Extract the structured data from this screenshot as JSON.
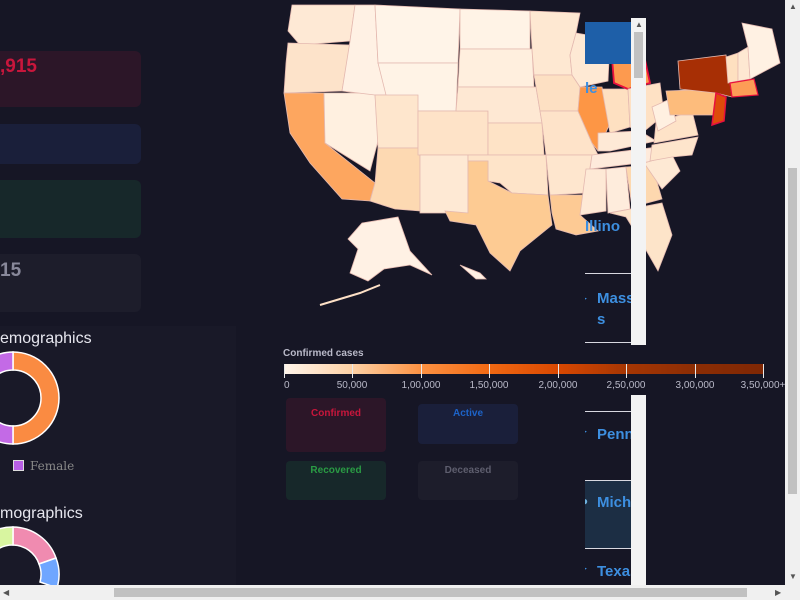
{
  "stats": {
    "confirmed_value": ",915",
    "deceased_value": "15"
  },
  "demographics": {
    "gender_title": "emographics",
    "gender_legend_female": "Female",
    "ethnicity_title": "mographics"
  },
  "state_list": {
    "items": [
      "Illino",
      "Mass\ns",
      "Penn",
      "Mich",
      "Texas"
    ],
    "partial_top_label": "le"
  },
  "scale": {
    "title": "Confirmed cases",
    "ticks": [
      "0",
      "50,000",
      "1,00,000",
      "1,50,000",
      "2,00,000",
      "2,50,000",
      "3,00,000",
      "3,50,000+"
    ]
  },
  "mini_cards": {
    "confirmed": "Confirmed",
    "active": "Active",
    "recovered": "Recovered",
    "deceased": "Deceased"
  },
  "colors": {
    "confirmed": "#c8163c",
    "active": "#1d63c8",
    "recovered": "#2a9b44",
    "deceased": "#5e5e6e",
    "link_blue": "#3d8fe0"
  }
}
